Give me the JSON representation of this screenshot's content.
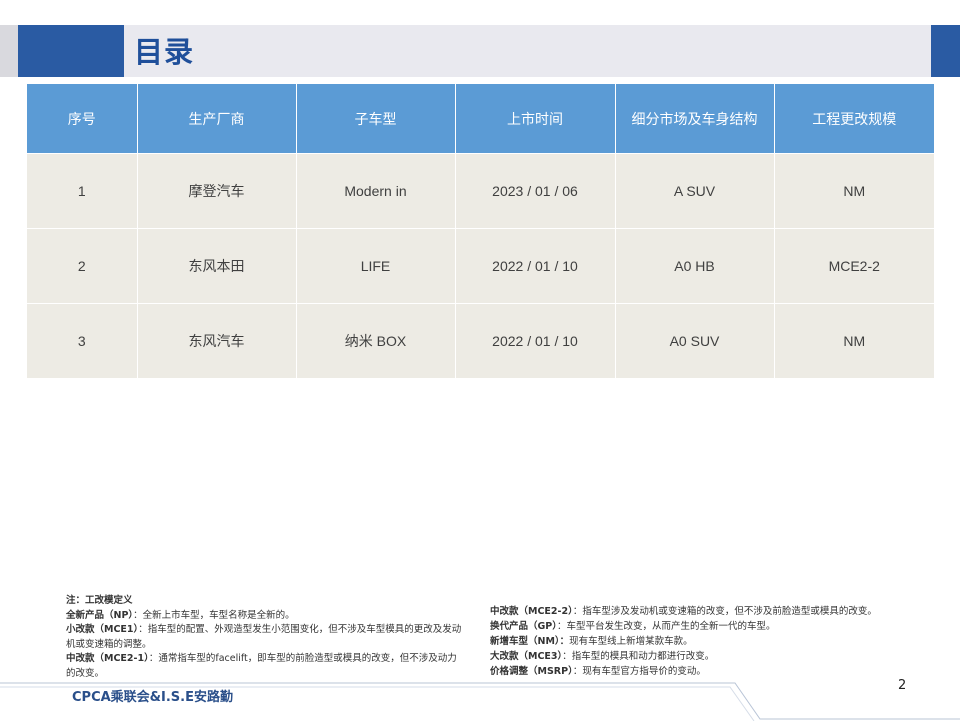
{
  "page": {
    "title": "目录",
    "page_number": "2",
    "footer": "CPCA乘联会&I.S.E安路勤"
  },
  "table": {
    "headers": [
      "序号",
      "生产厂商",
      "子车型",
      "上市时间",
      "细分市场及车身结构",
      "工程更改规模"
    ],
    "rows": [
      [
        "1",
        "摩登汽车",
        "Modern in",
        "2023 / 01 / 06",
        "A SUV",
        "NM"
      ],
      [
        "2",
        "东风本田",
        "LIFE",
        "2022 / 01 / 10",
        "A0 HB",
        "MCE2-2"
      ],
      [
        "3",
        "东风汽车",
        "纳米 BOX",
        "2022 / 01 / 10",
        "A0 SUV",
        "NM"
      ]
    ]
  },
  "notes": {
    "heading": "注：工改模定义",
    "left": [
      {
        "term": "全新产品（NP）",
        "desc": "：全新上市车型，车型名称是全新的。"
      },
      {
        "term": "小改款（MCE1）",
        "desc": "：指车型的配置、外观造型发生小范围变化，但不涉及车型模具的更改及发动机或变速箱的调整。"
      },
      {
        "term": "中改款（MCE2-1）",
        "desc": "：通常指车型的facelift，即车型的前脸造型或模具的改变，但不涉及动力的改变。"
      }
    ],
    "right": [
      {
        "term": "中改款（MCE2-2）",
        "desc": "：指车型涉及发动机或变速箱的改变，但不涉及前脸造型或模具的改变。"
      },
      {
        "term": "换代产品（GP）",
        "desc": "：车型平台发生改变，从而产生的全新一代的车型。"
      },
      {
        "term": "新增车型（NM）：",
        "desc": "现有车型线上新增某款车款。"
      },
      {
        "term": "大改款（MCE3）",
        "desc": "：指车型的模具和动力都进行改变。"
      },
      {
        "term": "价格调整（MSRP）",
        "desc": "：现有车型官方指导价的变动。"
      }
    ]
  },
  "colors": {
    "accent": "#2a5ba3",
    "header_bg": "#5b9bd5",
    "row_bg": "#edebe4",
    "title_text": "#1f4f9a"
  }
}
